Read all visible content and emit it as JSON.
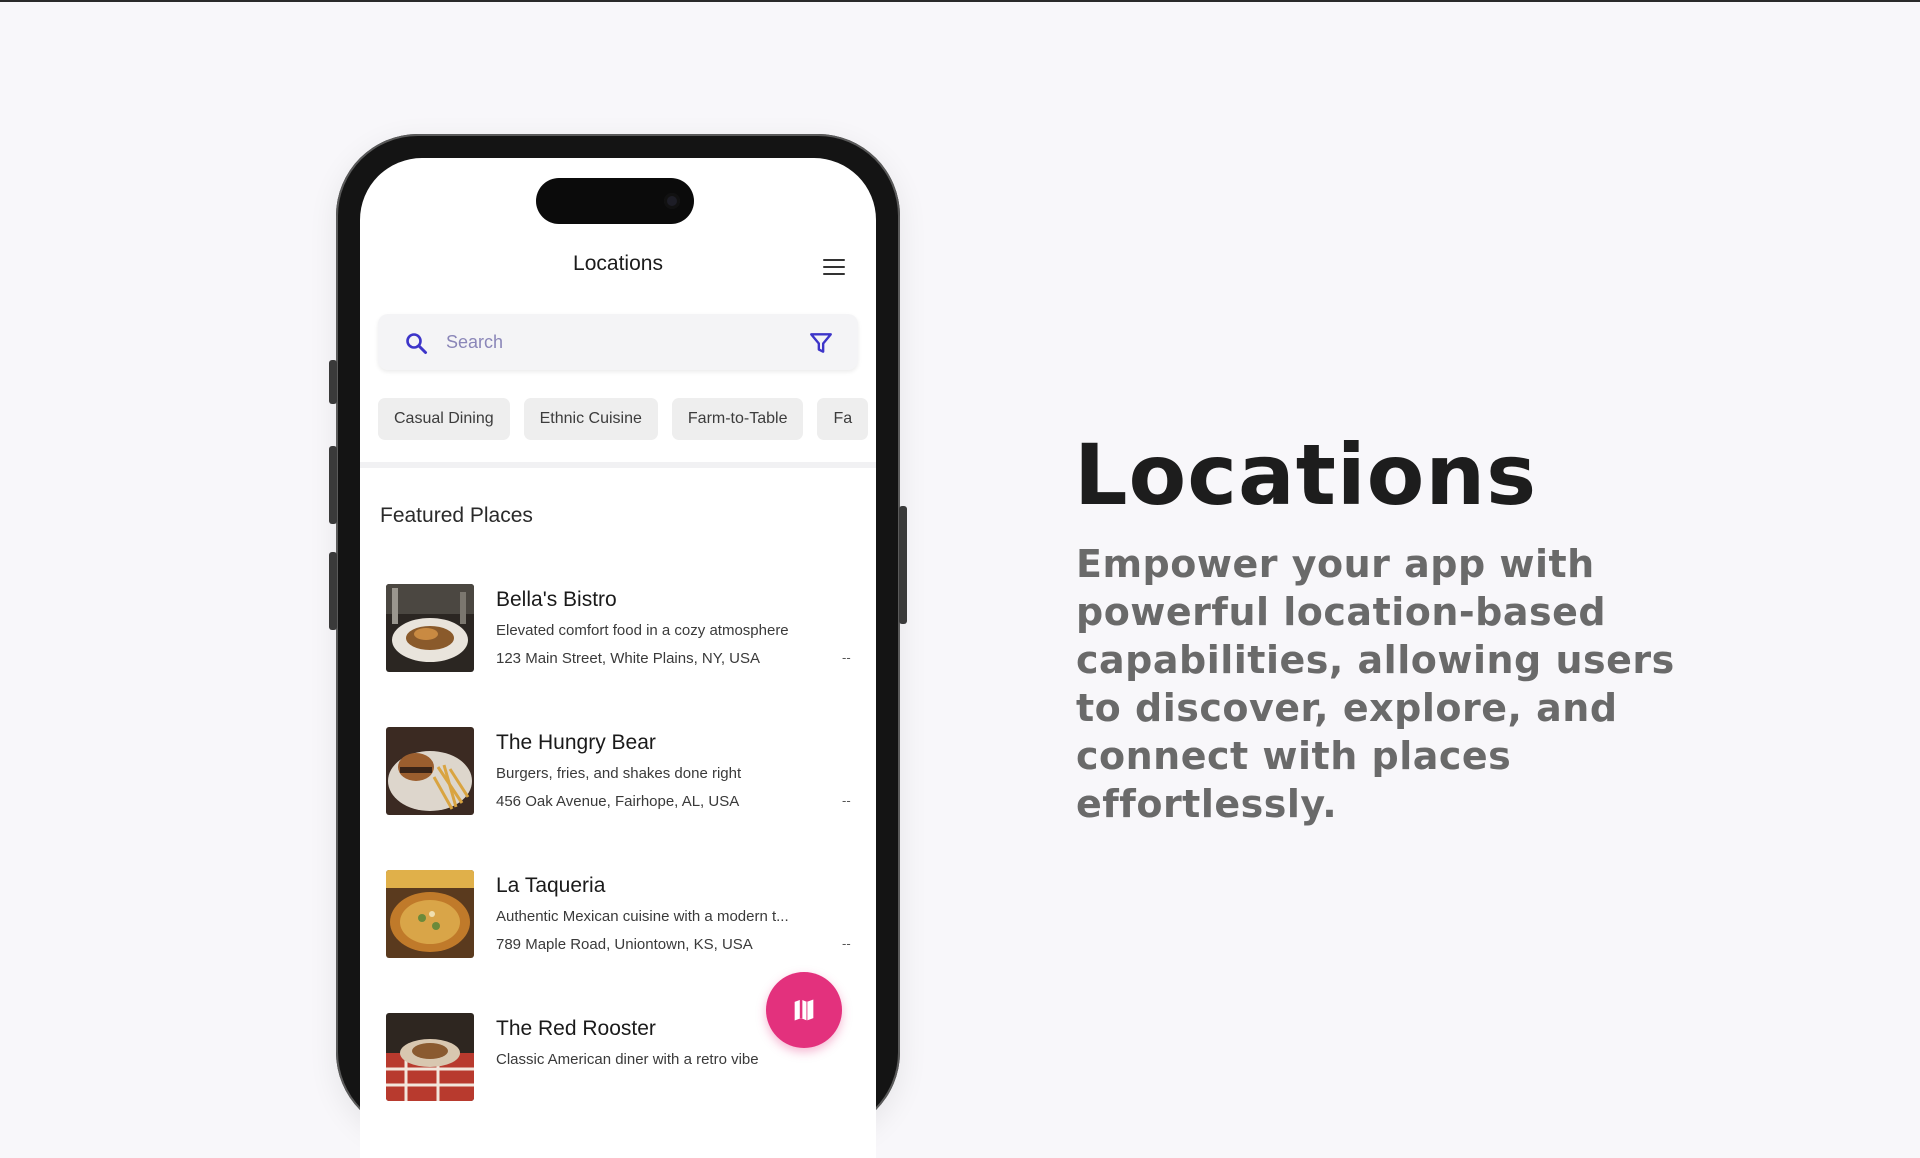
{
  "app": {
    "title": "Locations",
    "search": {
      "placeholder": "Search",
      "value": ""
    },
    "chips": [
      "Casual Dining",
      "Ethnic Cuisine",
      "Farm-to-Table",
      "Fa"
    ],
    "section_title": "Featured Places",
    "places": [
      {
        "name": "Bella's Bistro",
        "description": "Elevated comfort food in a cozy atmosphere",
        "address": "123 Main Street, White Plains, NY, USA",
        "distance": "--"
      },
      {
        "name": "The Hungry Bear",
        "description": "Burgers, fries, and shakes done right",
        "address": "456 Oak Avenue, Fairhope, AL, USA",
        "distance": "--"
      },
      {
        "name": "La Taqueria",
        "description": "Authentic Mexican cuisine with a modern t...",
        "address": "789 Maple Road, Uniontown, KS, USA",
        "distance": "--"
      },
      {
        "name": "The Red Rooster",
        "description": "Classic American diner with a retro vibe",
        "address": "",
        "distance": ""
      }
    ],
    "icons": {
      "menu": "hamburger-menu-icon",
      "search": "search-icon",
      "filter": "filter-icon",
      "fab": "map-icon"
    },
    "colors": {
      "accent": "#e3317d",
      "icon_blue": "#3d35c9",
      "placeholder": "#8a86b8"
    }
  },
  "hero": {
    "title": "Locations",
    "description": "Empower your app with powerful location-based capabilities, allowing users to discover, explore, and connect with places effortlessly."
  }
}
